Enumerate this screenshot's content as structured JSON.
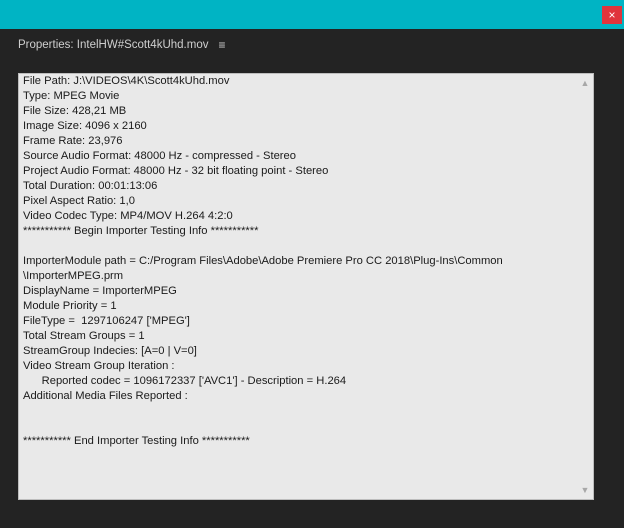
{
  "window": {
    "close_glyph": "×"
  },
  "panel": {
    "title": "Properties: IntelHW#Scott4kUhd.mov",
    "menu_glyph": "≡"
  },
  "scrollbar": {
    "up_glyph": "▲",
    "down_glyph": "▼"
  },
  "lines": [
    "File Path: J:\\VIDEOS\\4K\\Scott4kUhd.mov",
    "Type: MPEG Movie",
    "File Size: 428,21 MB",
    "Image Size: 4096 x 2160",
    "Frame Rate: 23,976",
    "Source Audio Format: 48000 Hz - compressed - Stereo",
    "Project Audio Format: 48000 Hz - 32 bit floating point - Stereo",
    "Total Duration: 00:01:13:06",
    "Pixel Aspect Ratio: 1,0",
    "Video Codec Type: MP4/MOV H.264 4:2:0",
    "*********** Begin Importer Testing Info ***********",
    "",
    "ImporterModule path = C:/Program Files\\Adobe\\Adobe Premiere Pro CC 2018\\Plug-Ins\\Common",
    "\\ImporterMPEG.prm",
    "DisplayName = ImporterMPEG",
    "Module Priority = 1",
    "FileType =  1297106247 ['MPEG']",
    "Total Stream Groups = 1",
    "StreamGroup Indecies: [A=0 | V=0]",
    "Video Stream Group Iteration :",
    "\t\tReported codec = 1096172337 ['AVC1'] - Description = H.264",
    "Additional Media Files Reported :",
    "",
    "",
    "*********** End Importer Testing Info ***********"
  ]
}
